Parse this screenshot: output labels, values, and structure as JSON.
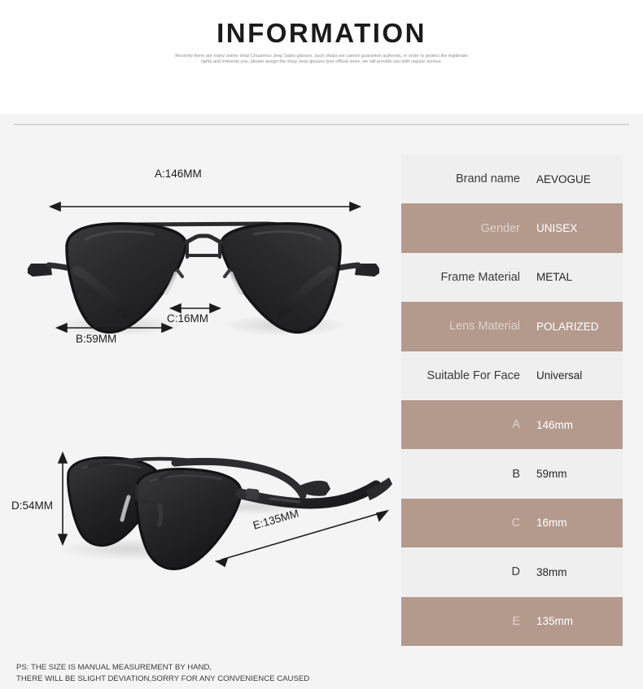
{
  "header": {
    "title": "INFORMATION",
    "notice_line1": "Recently there are many online shop Chuanhuo Jeep Sales glasses, such shops we cannot guarantee authentic, in order",
    "notice_line2": "to protect the legitimate rights and interests you, please assign the shop Jeep glasses lynx official store, we will provide",
    "notice_line3": "you with regular service."
  },
  "diagram": {
    "front": {
      "alt": "aviator-sunglasses-front-view",
      "dim_a": "A:146MM",
      "dim_b": "B:59MM",
      "dim_c": "C:16MM"
    },
    "side": {
      "alt": "aviator-sunglasses-angled-view",
      "dim_d": "D:54MM",
      "dim_e": "E:135MM"
    }
  },
  "spec_table": {
    "rows": [
      {
        "label": "Brand name",
        "value": "AEVOGUE",
        "shade": "light"
      },
      {
        "label": "Gender",
        "value": "UNISEX",
        "shade": "dark"
      },
      {
        "label": "Frame Material",
        "value": "METAL",
        "shade": "light"
      },
      {
        "label": "Lens Material",
        "value": "POLARIZED",
        "shade": "dark"
      },
      {
        "label": "Suitable For Face",
        "value": "Universal",
        "shade": "light"
      },
      {
        "label": "A",
        "value": "146mm",
        "shade": "dark"
      },
      {
        "label": "B",
        "value": "59mm",
        "shade": "light"
      },
      {
        "label": "C",
        "value": "16mm",
        "shade": "dark"
      },
      {
        "label": "D",
        "value": "38mm",
        "shade": "light"
      },
      {
        "label": "E",
        "value": "135mm",
        "shade": "dark"
      }
    ]
  },
  "footer": {
    "line1": "PS: THE SIZE IS MANUAL MEASUREMENT BY HAND,",
    "line2": "THERE WILL BE SLIGHT DEVIATION,SORRY FOR ANY CONVENIENCE CAUSED"
  },
  "colors": {
    "row_dark": "#b49a8d",
    "row_light": "#f0efef",
    "page_bg": "#f4f4f4",
    "header_bg": "#ffffff",
    "divider": "#d6d6d6"
  }
}
